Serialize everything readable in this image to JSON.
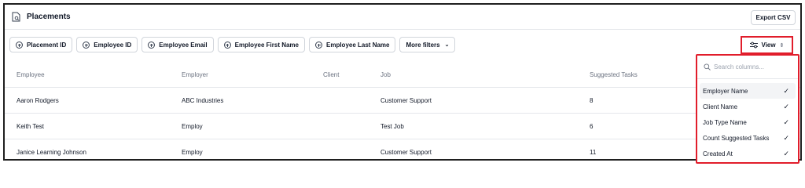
{
  "header": {
    "title": "Placements",
    "export_label": "Export CSV"
  },
  "filters": [
    {
      "label": "Placement ID"
    },
    {
      "label": "Employee ID"
    },
    {
      "label": "Employee Email"
    },
    {
      "label": "Employee First Name"
    },
    {
      "label": "Employee Last Name"
    }
  ],
  "more_filters_label": "More filters",
  "view_label": "View",
  "table": {
    "columns": [
      "Employee",
      "Employer",
      "Client",
      "Job",
      "Suggested Tasks"
    ],
    "rows": [
      [
        "Aaron Rodgers",
        "ABC Industries",
        "",
        "Customer Support",
        "8"
      ],
      [
        "Keith Test",
        "Employ",
        "",
        "Test Job",
        "6"
      ],
      [
        "Janice Learning Johnson",
        "Employ",
        "",
        "Customer Support",
        "11"
      ]
    ]
  },
  "column_menu": {
    "search_placeholder": "Search columns...",
    "options": [
      {
        "label": "Employer Name",
        "checked": true
      },
      {
        "label": "Client Name",
        "checked": true
      },
      {
        "label": "Job Type Name",
        "checked": true
      },
      {
        "label": "Count Suggested Tasks",
        "checked": true
      },
      {
        "label": "Created At",
        "checked": true
      }
    ]
  },
  "colors": {
    "highlight": "#e11d2b",
    "border": "#d1d5db",
    "muted": "#6b7280"
  }
}
